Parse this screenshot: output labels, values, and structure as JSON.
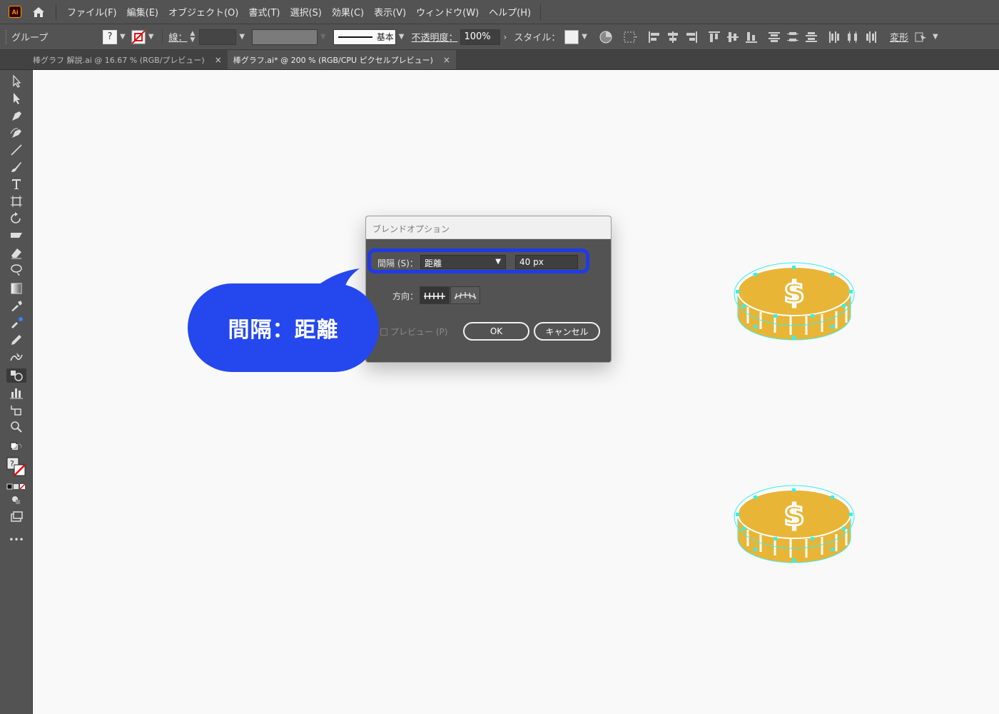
{
  "app": {
    "logo_text": "Ai",
    "accent_color": "#ff9a00"
  },
  "menu": {
    "items": [
      "ファイル(F)",
      "編集(E)",
      "オブジェクト(O)",
      "書式(T)",
      "選択(S)",
      "効果(C)",
      "表示(V)",
      "ウィンドウ(W)",
      "ヘルプ(H)"
    ]
  },
  "controlbar": {
    "selection_type": "グループ",
    "stroke_label": "線：",
    "stroke_style_label": "基本",
    "opacity_label": "不透明度：",
    "opacity_value": "100%",
    "style_label": "スタイル：",
    "transform_label": "変形"
  },
  "tabs": [
    {
      "label": "棒グラフ 解説.ai @ 16.67 % (RGB/プレビュー)",
      "close": "×",
      "active": false
    },
    {
      "label": "棒グラフ.ai* @ 200 % (RGB/CPU ピクセルプレビュー)",
      "close": "×",
      "active": true
    }
  ],
  "dialog": {
    "title": "ブレンドオプション",
    "spacing_label": "間隔 (S)：",
    "spacing_option": "距離",
    "spacing_value": "40 px",
    "orientation_label": "方向：",
    "preview_label": "プレビュー (P)",
    "ok_label": "OK",
    "cancel_label": "キャンセル",
    "highlight_color": "#1f3ae6"
  },
  "callout": {
    "text": "間隔：距離",
    "color": "#2448ee"
  },
  "artwork": {
    "coin_color": "#e8b537",
    "selection_color": "#33f0f0",
    "symbol": "$"
  },
  "toolbar": {
    "more_label": "•••"
  }
}
